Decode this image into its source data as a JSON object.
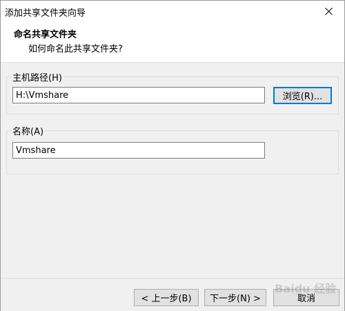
{
  "window": {
    "title": "添加共享文件夹向导"
  },
  "header": {
    "title": "命名共享文件夹",
    "subtitle": "如何命名此共享文件夹?"
  },
  "host_path": {
    "label": "主机路径(H)",
    "value": "H:\\Vmshare",
    "browse_label": "浏览(R)..."
  },
  "name": {
    "label": "名称(A)",
    "value": "Vmshare"
  },
  "buttons": {
    "back": "< 上一步(B)",
    "next": "下一步(N) >",
    "cancel": "取消"
  },
  "watermark": {
    "text": "Baidu 经验"
  },
  "colors": {
    "accent": "#0078d7",
    "content_bg": "#f0f0f0"
  },
  "icons": {
    "close": "close-icon"
  }
}
